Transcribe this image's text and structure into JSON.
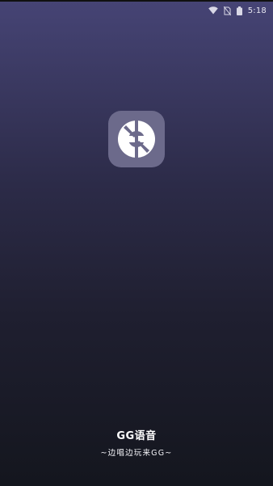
{
  "status_bar": {
    "time": "5:18",
    "icons": [
      "wifi-icon",
      "no-sim-icon",
      "battery-icon"
    ]
  },
  "app": {
    "name": "GG语音",
    "slogan": "~边唱边玩来GG~",
    "logo_icon": "gg-logo-icon"
  },
  "colors": {
    "gradient_top": "#464475",
    "gradient_bottom": "#14161e",
    "logo_bg": "#6c6a8b"
  }
}
